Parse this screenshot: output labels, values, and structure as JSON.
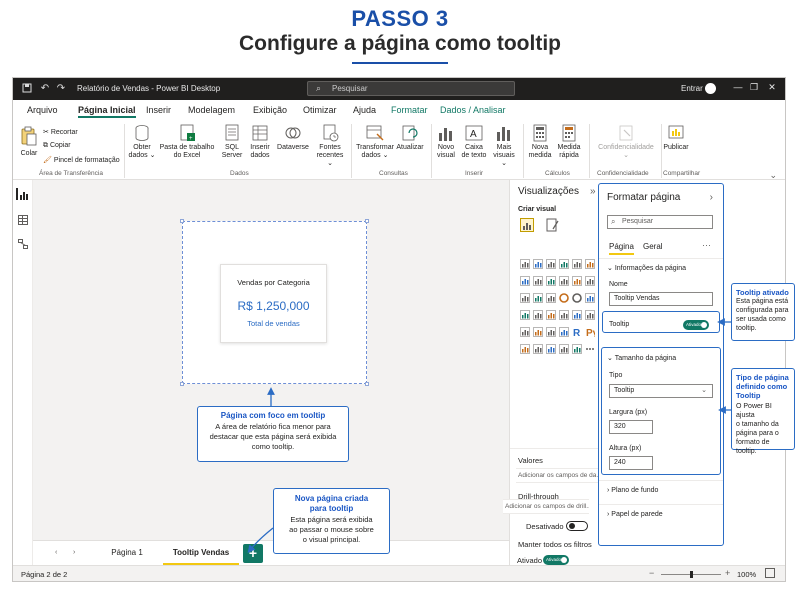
{
  "header": {
    "step": "PASSO 3",
    "subtitle": "Configure a página como tooltip"
  },
  "window": {
    "title": "Relatório de Vendas - Power BI Desktop",
    "search_placeholder": "Pesquisar",
    "signin": "Entrar"
  },
  "menu": {
    "tabs": [
      "Arquivo",
      "Página Inicial",
      "Inserir",
      "Modelagem",
      "Exibição",
      "Otimizar",
      "Ajuda",
      "Formatar",
      "Dados / Analisar"
    ],
    "active_tab": "Página Inicial"
  },
  "ribbon": {
    "paste": "Colar",
    "cut": "Recortar",
    "copy": "Copiar",
    "format_painter": "Pincel de formatação",
    "group_clipboard": "Área de Transferência",
    "get_data_1": "Obter",
    "get_data_2": "dados ⌄",
    "excel_1": "Pasta de trabalho",
    "excel_2": "do Excel",
    "sql_1": "SQL",
    "sql_2": "Server",
    "insert_data_1": "Inserir",
    "insert_data_2": "dados",
    "dataverse": "Dataverse",
    "recent_1": "Fontes",
    "recent_2": "recentes ⌄",
    "group_data": "Dados",
    "transform_1": "Transformar",
    "transform_2": "dados ⌄",
    "refresh": "Atualizar",
    "group_queries": "Consultas",
    "new_visual_1": "Novo",
    "new_visual_2": "visual",
    "textbox_1": "Caixa",
    "textbox_2": "de texto",
    "more_visuals_1": "Mais",
    "more_visuals_2": "visuais ⌄",
    "group_insert": "Inserir",
    "new_measure_1": "Nova",
    "new_measure_2": "medida",
    "quick_measure_1": "Medida",
    "quick_measure_2": "rápida",
    "group_calc": "Cálculos",
    "sensitivity": "Confidencialidade",
    "group_sensitivity": "Confidencialidade",
    "publish": "Publicar",
    "group_share": "Compartilhar"
  },
  "canvas": {
    "card_title": "Vendas por Categoria",
    "card_value": "R$ 1,250,000",
    "card_subtitle": "Total de vendas"
  },
  "callouts": {
    "focus_title": "Página com foco em tooltip",
    "focus_body_1": "A área de relatório fica menor para",
    "focus_body_2": "destacar que esta página será exibida",
    "focus_body_3": "como tooltip.",
    "new_page_title_1": "Nova página criada",
    "new_page_title_2": "para tooltip",
    "new_page_body_1": "Esta página será exibida",
    "new_page_body_2": "ao passar o mouse sobre",
    "new_page_body_3": "o visual principal.",
    "tooltip_on_title": "Tooltip ativado",
    "tooltip_on_body_1": "Esta página está",
    "tooltip_on_body_2": "configurada para",
    "tooltip_on_body_3": "ser usada como",
    "tooltip_on_body_4": "tooltip.",
    "page_type_title_1": "Tipo de página",
    "page_type_title_2": "definido como",
    "page_type_title_3": "Tooltip",
    "page_type_body_1": "O Power BI ajusta",
    "page_type_body_2": "o tamanho da",
    "page_type_body_3": "página para o",
    "page_type_body_4": "formato de tooltip."
  },
  "pages": {
    "tab1": "Página 1",
    "tab2": "Tooltip Vendas",
    "add": "+"
  },
  "status": {
    "page_indicator": "Página 2 de 2",
    "zoom": "100%",
    "zoom_level": 0.5
  },
  "viz_pane": {
    "title": "Visualizações",
    "build_visual": "Criar visual",
    "values_label": "Valores",
    "values_placeholder": "Adicionar os campos de da...",
    "drillthrough": "Drill-through",
    "cross_report": "Relatório cruzado",
    "off_label": "Desativado",
    "keep_filters": "Manter todos os filtros",
    "on_label": "Ativado",
    "toggle_on_text": "Ativado",
    "drill_placeholder": "Adicionar os campos de drill..."
  },
  "format_pane": {
    "title": "Formatar página",
    "search_placeholder": "Pesquisar",
    "tab_page": "Página",
    "tab_general": "Geral",
    "more": "···",
    "section_info": "Informações da página",
    "name_label": "Nome",
    "name_value": "Tooltip Vendas",
    "tooltip_label": "Tooltip",
    "tooltip_toggle": "Ativado",
    "section_size": "Tamanho da página",
    "type_label": "Tipo",
    "type_value": "Tooltip",
    "width_label": "Largura (px)",
    "width_value": "320",
    "height_label": "Altura (px)",
    "height_value": "240",
    "section_bg": "Plano de fundo",
    "section_wallpaper": "Papel de parede"
  },
  "colors": {
    "accent_blue": "#2b6cc4",
    "title_blue": "#1a4fa8",
    "pbi_green": "#117865",
    "pbi_yellow": "#f2c811"
  }
}
